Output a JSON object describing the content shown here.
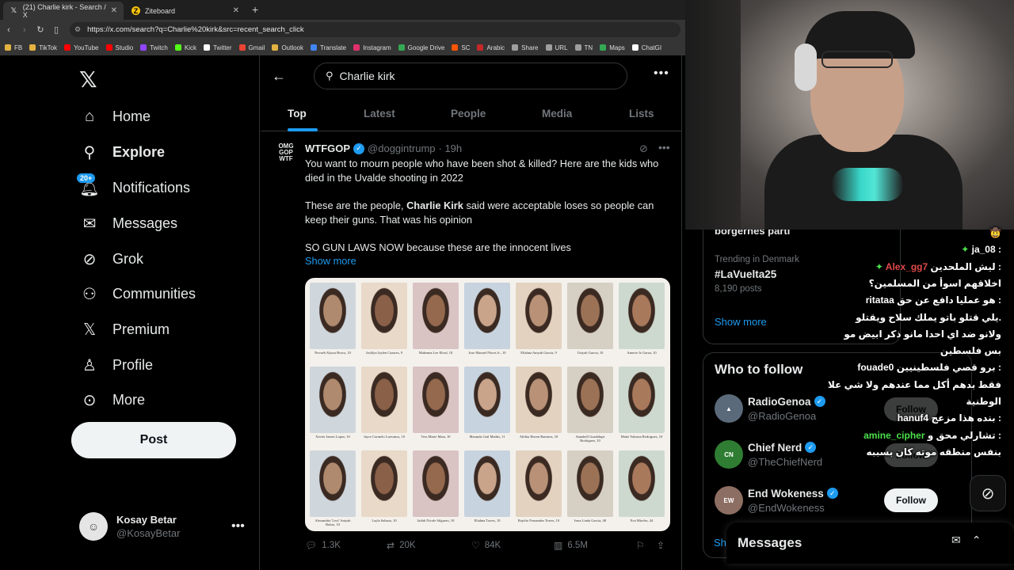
{
  "browser": {
    "tabs": [
      {
        "title": "(21) Charlie kirk - Search / X",
        "icon": "x-logo-icon"
      },
      {
        "title": "Ziteboard",
        "icon": "ziteboard-icon"
      }
    ],
    "url": "https://x.com/search?q=Charlie%20kirk&src=recent_search_click",
    "bookmarks": [
      {
        "label": "FB",
        "color": "#e3b341"
      },
      {
        "label": "TikTok",
        "color": "#e3b341"
      },
      {
        "label": "YouTube",
        "color": "#ff0000"
      },
      {
        "label": "Studio",
        "color": "#ff0000"
      },
      {
        "label": "Twitch",
        "color": "#9146ff"
      },
      {
        "label": "Kick",
        "color": "#53fc18"
      },
      {
        "label": "Twitter",
        "color": "#ffffff"
      },
      {
        "label": "Gmail",
        "color": "#ea4335"
      },
      {
        "label": "Outlook",
        "color": "#e3b341"
      },
      {
        "label": "Translate",
        "color": "#4285f4"
      },
      {
        "label": "Instagram",
        "color": "#e1306c"
      },
      {
        "label": "Google Drive",
        "color": "#34a853"
      },
      {
        "label": "SC",
        "color": "#ff5500"
      },
      {
        "label": "Arabic",
        "color": "#c62828"
      },
      {
        "label": "Share",
        "color": "#9e9e9e"
      },
      {
        "label": "URL",
        "color": "#9e9e9e"
      },
      {
        "label": "TN",
        "color": "#9e9e9e"
      },
      {
        "label": "Maps",
        "color": "#34a853"
      },
      {
        "label": "ChatGI",
        "color": "#ffffff"
      }
    ]
  },
  "nav": {
    "items": [
      {
        "label": "Home",
        "icon": "home-icon",
        "glyph": "⌂"
      },
      {
        "label": "Explore",
        "icon": "search-icon",
        "glyph": "⌕"
      },
      {
        "label": "Notifications",
        "icon": "bell-icon",
        "glyph": "🔔"
      },
      {
        "label": "Messages",
        "icon": "mail-icon",
        "glyph": "✉"
      },
      {
        "label": "Grok",
        "icon": "grok-icon",
        "glyph": "⊘"
      },
      {
        "label": "Communities",
        "icon": "communities-icon",
        "glyph": "👥"
      },
      {
        "label": "Premium",
        "icon": "x-premium-icon",
        "glyph": "𝕏"
      },
      {
        "label": "Profile",
        "icon": "person-icon",
        "glyph": "👤"
      },
      {
        "label": "More",
        "icon": "more-circle-icon",
        "glyph": "⋯"
      }
    ],
    "notif_badge": "20+",
    "post_label": "Post",
    "account": {
      "name": "Kosay Betar",
      "handle": "@KosayBetar"
    }
  },
  "search": {
    "query": "Charlie kirk",
    "tabs": [
      "Top",
      "Latest",
      "People",
      "Media",
      "Lists"
    ],
    "active_tab": "Top"
  },
  "tweet": {
    "avatar_text": "OMG GOP WTF",
    "name": "WTFGOP",
    "handle": "@doggintrump",
    "time": "· 19h",
    "text1": "You want to mourn people who have been shot & killed? Here are the kids who died in the Uvalde shooting in 2022",
    "text2_bold": "Charlie Kirk",
    "text2_before": "These are the people, ",
    "text2_after": " said were acceptable loses so people can keep their guns. That was his opinion",
    "text3": "SO GUN LAWS NOW because these are the innocent lives",
    "show_more": "Show more",
    "victims": [
      "Nevaeh Alyssa Bravo, 10",
      "Jacklyn Jaylen Cazares, 9",
      "Makenna Lee Elrod, 10",
      "Jose Manuel Flores Jr., 10",
      "Eliahna Amyah Garcia, 9",
      "Uziyah Garcia, 10",
      "Amerie Jo Garza, 10",
      "Xavier James Lopez, 10",
      "Jayce Carmelo Luevanos, 10",
      "Tess Marie Mata, 10",
      "Maranda Gail Mathis, 11",
      "Alithia Haven Ramirez, 10",
      "Annabell Guadalupe Rodriguez, 10",
      "Maite Yuleana Rodriguez, 10",
      "Alexandria 'Lexi' Aniyah Rubio, 10",
      "Layla Salazar, 10",
      "Jailah Nicole Silguero, 10",
      "Eliahna Torres, 10",
      "Rojelio Fernandez Torres, 10",
      "Irma Linda Garcia, 48",
      "Eva Mireles, 44"
    ],
    "stats": {
      "replies": "1.3K",
      "reposts": "20K",
      "likes": "84K",
      "views": "6.5M"
    }
  },
  "sidebar": {
    "trend_top_partial": "borgernes parti",
    "trend_category": "Trending in Denmark",
    "trend_name": "#LaVuelta25",
    "trend_posts": "8,190 posts",
    "show_more": "Show more",
    "who_to_follow_title": "Who to follow",
    "follow_accounts": [
      {
        "name": "RadioGenoa",
        "handle": "@RadioGenoa",
        "color": "#5a6a7a"
      },
      {
        "name": "Chief Nerd",
        "handle": "@TheChiefNerd",
        "color": "#2e7d32"
      },
      {
        "name": "End Wokeness",
        "handle": "@EndWokeness",
        "color": "#8d6e63"
      }
    ],
    "follow_label": "Follow",
    "show_partial": "Sh",
    "messages_title": "Messages"
  },
  "chat": [
    {
      "user": "",
      "msg": "🤠"
    },
    {
      "user": "ja_08",
      "msg": ":",
      "user_color": "white",
      "gem": true
    },
    {
      "user": "Alex_gg7",
      "msg": "ليش الملحدين :",
      "user_color": "red",
      "gem": true
    },
    {
      "user": "",
      "msg": "اخلاقهم اسوأ من المسلمين؟"
    },
    {
      "user": "ritataa",
      "msg": "هو عمليا دافع عن حق :"
    },
    {
      "user": "",
      "msg": "يلي قتلو باتو يملك سلاح ويقتلو."
    },
    {
      "user": "",
      "msg": "ولانو ضد اي احدا مانو ذكر ابيض مو"
    },
    {
      "user": "",
      "msg": "بس فلسطين"
    },
    {
      "user": "fouade0",
      "msg": "برو قصي فلسطينيين :"
    },
    {
      "user": "",
      "msg": "فقط بدهم أكل مما عندهم ولا شي علا"
    },
    {
      "user": "",
      "msg": "الوطنية"
    },
    {
      "user": "hanuf4",
      "msg": "بنده هذا مزعج :"
    },
    {
      "user": "amine_cipher",
      "msg": "تشارلي محق و :",
      "user_color": "green"
    },
    {
      "user": "",
      "msg": "بنفس منطقه موته كان بسببه"
    }
  ]
}
